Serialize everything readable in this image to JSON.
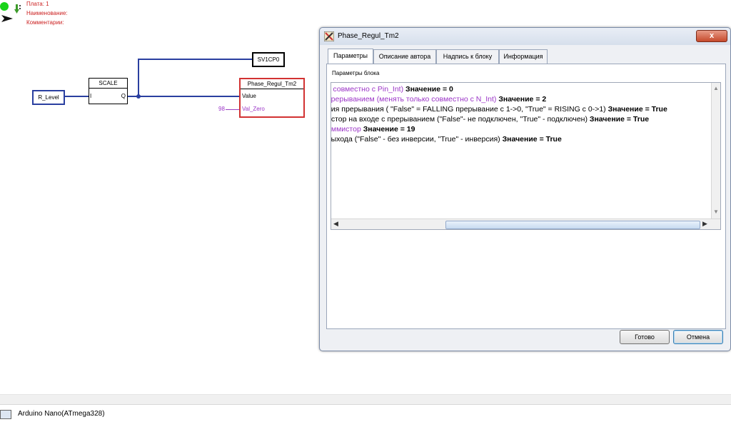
{
  "board_info": {
    "board": "Плата: 1",
    "name": "Наименование:",
    "comments": "Комментарии:"
  },
  "diagram": {
    "r_level": "R_Level",
    "scale": {
      "title": "SCALE",
      "in": "I",
      "out": "Q"
    },
    "sv1cp0": "SV1CP0",
    "phase_block": {
      "title": "Phase_Regul_Tm2",
      "pin1": "Value",
      "pin2": "Val_Zero"
    },
    "const_98": "98"
  },
  "dialog": {
    "title": "Phase_Regul_Tm2",
    "close": "x",
    "tabs": [
      "Параметры",
      "Описание автора",
      "Надпись к блоку",
      "Информация"
    ],
    "panel_label": "Параметры блока",
    "params": [
      {
        "text": "ь совместно с Pin_Int)",
        "value": "Значение = 0",
        "color": "#9b35c7"
      },
      {
        "text": " прерыванием (менять только совместно с N_Int)",
        "value": "Значение = 2",
        "color": "#9b35c7"
      },
      {
        "text": "ния прерывания ( \"False\" = FALLING прерывание с 1->0, \"True\" = RISING  с 0->1)",
        "value": "Значение = True",
        "color": "#000000"
      },
      {
        "text": "истор на входе с прерыванием (\"False\"- не подключен, \"True\" - подключен)",
        "value": "Значение = True",
        "color": "#000000"
      },
      {
        "text": "иммистор",
        "value": "Значение = 19",
        "color": "#9b35c7"
      },
      {
        "text": " выхода (\"False\" - без инверсии, \"True\" - инверсия)",
        "value": "Значение = True",
        "color": "#000000"
      }
    ],
    "ok": "Готово",
    "cancel": "Отмена"
  },
  "status": {
    "device": "Arduino Nano(ATmega328)"
  }
}
